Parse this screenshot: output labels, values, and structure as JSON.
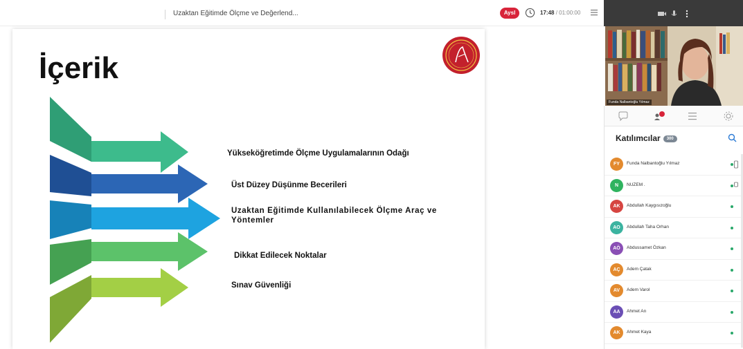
{
  "topbar": {
    "session_title": "Uzaktan Eğitimde Ölçme ve Değerlend...",
    "live_label": "Aysl",
    "time_current": "17:48",
    "time_total": " / 01:00:00"
  },
  "slide": {
    "title": "İçerik",
    "items": [
      "Yükseköğretimde Ölçme Uygulamalarının Odağı",
      "Üst Düzey Düşünme Becerileri",
      "Uzaktan Eğitimde Kullanılabilecek Ölçme Araç ve",
      "Yöntemler",
      "Dikkat Edilecek Noktalar",
      "Sınav Güvenliği"
    ],
    "arrow_colors": [
      "#3dbb8c",
      "#2c66b5",
      "#1ea3e0",
      "#5cc26a",
      "#a3cf45"
    ]
  },
  "video": {
    "speaker_name": "Funda Nalbantoğlu Yılmaz"
  },
  "panel": {
    "header": "Katılımcılar",
    "count": "300",
    "participants": [
      {
        "initials": "FY",
        "name": "Funda Nalbantoğlu Yılmaz",
        "color": "#e38a2e"
      },
      {
        "initials": "N",
        "name": "NUZEM .",
        "color": "#2fb35f"
      },
      {
        "initials": "AK",
        "name": "Abdullah Kaygısızoğlu",
        "color": "#d64541"
      },
      {
        "initials": "AO",
        "name": "Abdullah Taha Orhan",
        "color": "#3bb3a0"
      },
      {
        "initials": "AÖ",
        "name": "Abdussamet Özkan",
        "color": "#8a4fb5"
      },
      {
        "initials": "AÇ",
        "name": "Adem Çatak",
        "color": "#e38a2e"
      },
      {
        "initials": "AV",
        "name": "Adem Varol",
        "color": "#e38a2e"
      },
      {
        "initials": "AA",
        "name": "Ahmet An",
        "color": "#6b4fb5"
      },
      {
        "initials": "AK",
        "name": "Ahmet Kaya",
        "color": "#e38a2e"
      }
    ]
  }
}
